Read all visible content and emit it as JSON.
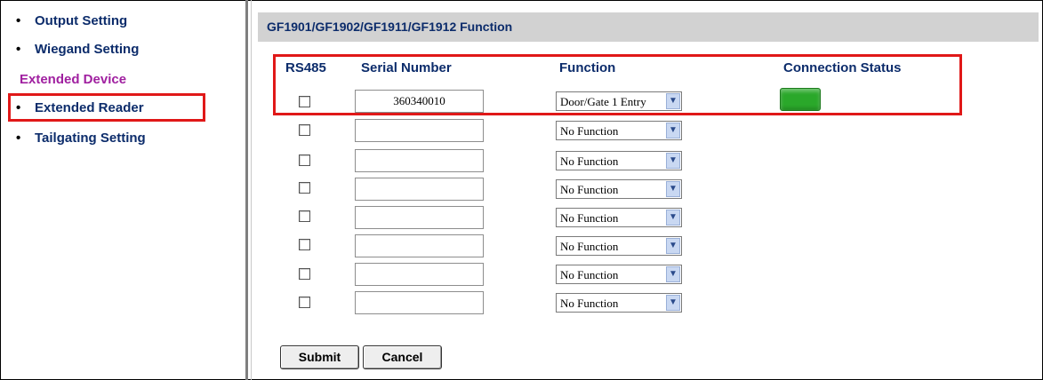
{
  "sidebar": {
    "items": [
      {
        "label": "Output Setting"
      },
      {
        "label": "Wiegand Setting"
      },
      {
        "label": "Extended Reader"
      },
      {
        "label": "Tailgating Setting"
      }
    ],
    "heading": "Extended Device",
    "bullet": "•"
  },
  "main": {
    "title": "GF1901/GF1902/GF1911/GF1912 Function",
    "columns": {
      "rs485": "RS485",
      "serial": "Serial Number",
      "function": "Function",
      "status": "Connection Status"
    },
    "rows": [
      {
        "serial": "360340010",
        "function": "Door/Gate 1 Entry",
        "connected": true
      },
      {
        "serial": "",
        "function": "No Function",
        "connected": false
      },
      {
        "serial": "",
        "function": "No Function",
        "connected": false
      },
      {
        "serial": "",
        "function": "No Function",
        "connected": false
      },
      {
        "serial": "",
        "function": "No Function",
        "connected": false
      },
      {
        "serial": "",
        "function": "No Function",
        "connected": false
      },
      {
        "serial": "",
        "function": "No Function",
        "connected": false
      },
      {
        "serial": "",
        "function": "No Function",
        "connected": false
      }
    ],
    "submit_label": "Submit",
    "cancel_label": "Cancel",
    "dropdown_arrow": "▼"
  },
  "colors": {
    "highlight": "#e01818",
    "nav_text": "#0c2c6b",
    "heading_text": "#a020a0",
    "status_connected": "#2aa82a"
  }
}
